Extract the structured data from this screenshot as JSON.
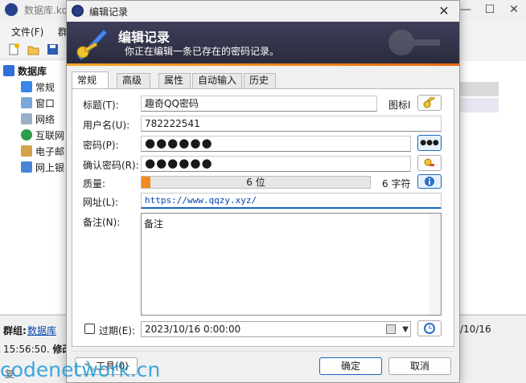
{
  "main_window": {
    "title": "数据库.kd",
    "menu": [
      "文件(F)",
      "群"
    ],
    "tree": [
      {
        "label": "数据库",
        "icon": "folder-open-icon",
        "color": "#2f6fdb"
      },
      {
        "label": "常规",
        "icon": "folder-icon",
        "color": "#3a86e8"
      },
      {
        "label": "窗口",
        "icon": "window-icon",
        "color": "#7aa6d8"
      },
      {
        "label": "网络",
        "icon": "server-icon",
        "color": "#9ab0c8"
      },
      {
        "label": "互联网",
        "icon": "globe-icon",
        "color": "#2e9b4d"
      },
      {
        "label": "电子邮",
        "icon": "mail-icon",
        "color": "#d3a24a"
      },
      {
        "label": "网上银",
        "icon": "percent-icon",
        "color": "#4a86d8"
      }
    ],
    "status": {
      "group_label": "群组:",
      "group_link": "数据库",
      "group_tail": ".",
      "time_text": "15:56:50.",
      "time_bold": "修改",
      "right_date": "/10/16"
    },
    "bottom_text": "复"
  },
  "dialog": {
    "title": "编辑记录",
    "banner": {
      "title": "编辑记录",
      "subtitle": "你正在编辑一条已存在的密码记录。"
    },
    "tabs": [
      "常规",
      "高级",
      "属性",
      "自动输入",
      "历史"
    ],
    "active_tab": 0,
    "fields": {
      "title_label": "标题(T):",
      "title_value": "趣奇QQ密码",
      "icon_label": "图标I",
      "username_label": "用户名(U):",
      "username_value": "782222541",
      "password_label": "密码(P):",
      "password_value": "●●●●●●",
      "show_password_label": "●●●",
      "confirm_label": "确认密码(R):",
      "confirm_value": "●●●●●●",
      "quality_label": "质量:",
      "quality_bar_text": "6 位",
      "quality_fraction": 0.04,
      "quality_chars": "6 字符",
      "url_label": "网址(L):",
      "url_value": "https://www.qqzy.xyz/",
      "notes_label": "备注(N):",
      "notes_value": "备注",
      "expiry_label": "过期(E):",
      "expiry_value": "2023/10/16  0:00:00"
    },
    "buttons": {
      "tools": "工具(0)",
      "ok": "确定",
      "cancel": "取消"
    }
  },
  "watermark": "codenetwork.cn",
  "colors": {
    "banner": "#2b2b3e",
    "accent_orange": "#f28a20",
    "link": "#0645ad",
    "ok_border": "#1a66c2"
  }
}
